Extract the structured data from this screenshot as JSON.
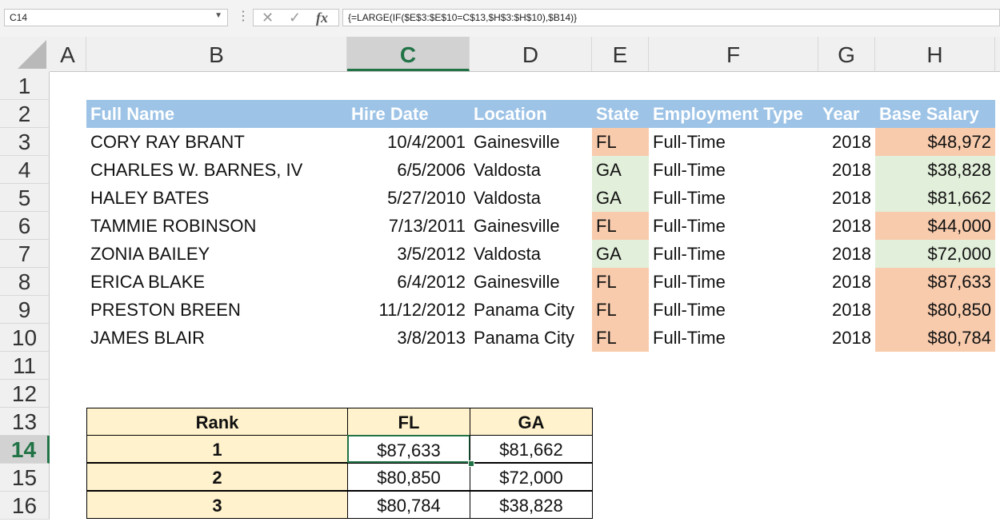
{
  "name_box": "C14",
  "formula_bar": {
    "cancel_icon": "✕",
    "enter_icon": "✓",
    "fx_label": "fx",
    "formula": "{=LARGE(IF($E$3:$E$10=C$13,$H$3:$H$10),$B14)}"
  },
  "columns": [
    "A",
    "B",
    "C",
    "D",
    "E",
    "F",
    "G",
    "H"
  ],
  "rows": [
    "1",
    "2",
    "3",
    "4",
    "5",
    "6",
    "7",
    "8",
    "9",
    "10",
    "11",
    "12",
    "13",
    "14",
    "15",
    "16"
  ],
  "headers": {
    "full_name": "Full Name",
    "hire_date": "Hire Date",
    "location": "Location",
    "state": "State",
    "employment_type": "Employment Type",
    "year": "Year",
    "base_salary": "Base Salary"
  },
  "employees": [
    {
      "name": "CORY RAY BRANT",
      "hire_date": "10/4/2001",
      "location": "Gainesville",
      "state": "FL",
      "type": "Full-Time",
      "year": "2018",
      "salary": "$48,972"
    },
    {
      "name": "CHARLES W. BARNES, IV",
      "hire_date": "6/5/2006",
      "location": "Valdosta",
      "state": "GA",
      "type": "Full-Time",
      "year": "2018",
      "salary": "$38,828"
    },
    {
      "name": "HALEY BATES",
      "hire_date": "5/27/2010",
      "location": "Valdosta",
      "state": "GA",
      "type": "Full-Time",
      "year": "2018",
      "salary": "$81,662"
    },
    {
      "name": "TAMMIE ROBINSON",
      "hire_date": "7/13/2011",
      "location": "Gainesville",
      "state": "FL",
      "type": "Full-Time",
      "year": "2018",
      "salary": "$44,000"
    },
    {
      "name": "ZONIA BAILEY",
      "hire_date": "3/5/2012",
      "location": "Valdosta",
      "state": "GA",
      "type": "Full-Time",
      "year": "2018",
      "salary": "$72,000"
    },
    {
      "name": "ERICA BLAKE",
      "hire_date": "6/4/2012",
      "location": "Gainesville",
      "state": "FL",
      "type": "Full-Time",
      "year": "2018",
      "salary": "$87,633"
    },
    {
      "name": "PRESTON BREEN",
      "hire_date": "11/12/2012",
      "location": "Panama City",
      "state": "FL",
      "type": "Full-Time",
      "year": "2018",
      "salary": "$80,850"
    },
    {
      "name": "JAMES BLAIR",
      "hire_date": "3/8/2013",
      "location": "Panama City",
      "state": "FL",
      "type": "Full-Time",
      "year": "2018",
      "salary": "$80,784"
    }
  ],
  "rank_table": {
    "headers": {
      "rank": "Rank",
      "fl": "FL",
      "ga": "GA"
    },
    "rows": [
      {
        "rank": "1",
        "fl": "$87,633",
        "ga": "$81,662"
      },
      {
        "rank": "2",
        "fl": "$80,850",
        "ga": "$72,000"
      },
      {
        "rank": "3",
        "fl": "$80,784",
        "ga": "$38,828"
      }
    ]
  },
  "colors": {
    "accent": "#217346",
    "header_blue": "#9dc3e6",
    "fl_fill": "#f8cbad",
    "ga_fill": "#e2efda",
    "rank_fill": "#fff2cc"
  }
}
